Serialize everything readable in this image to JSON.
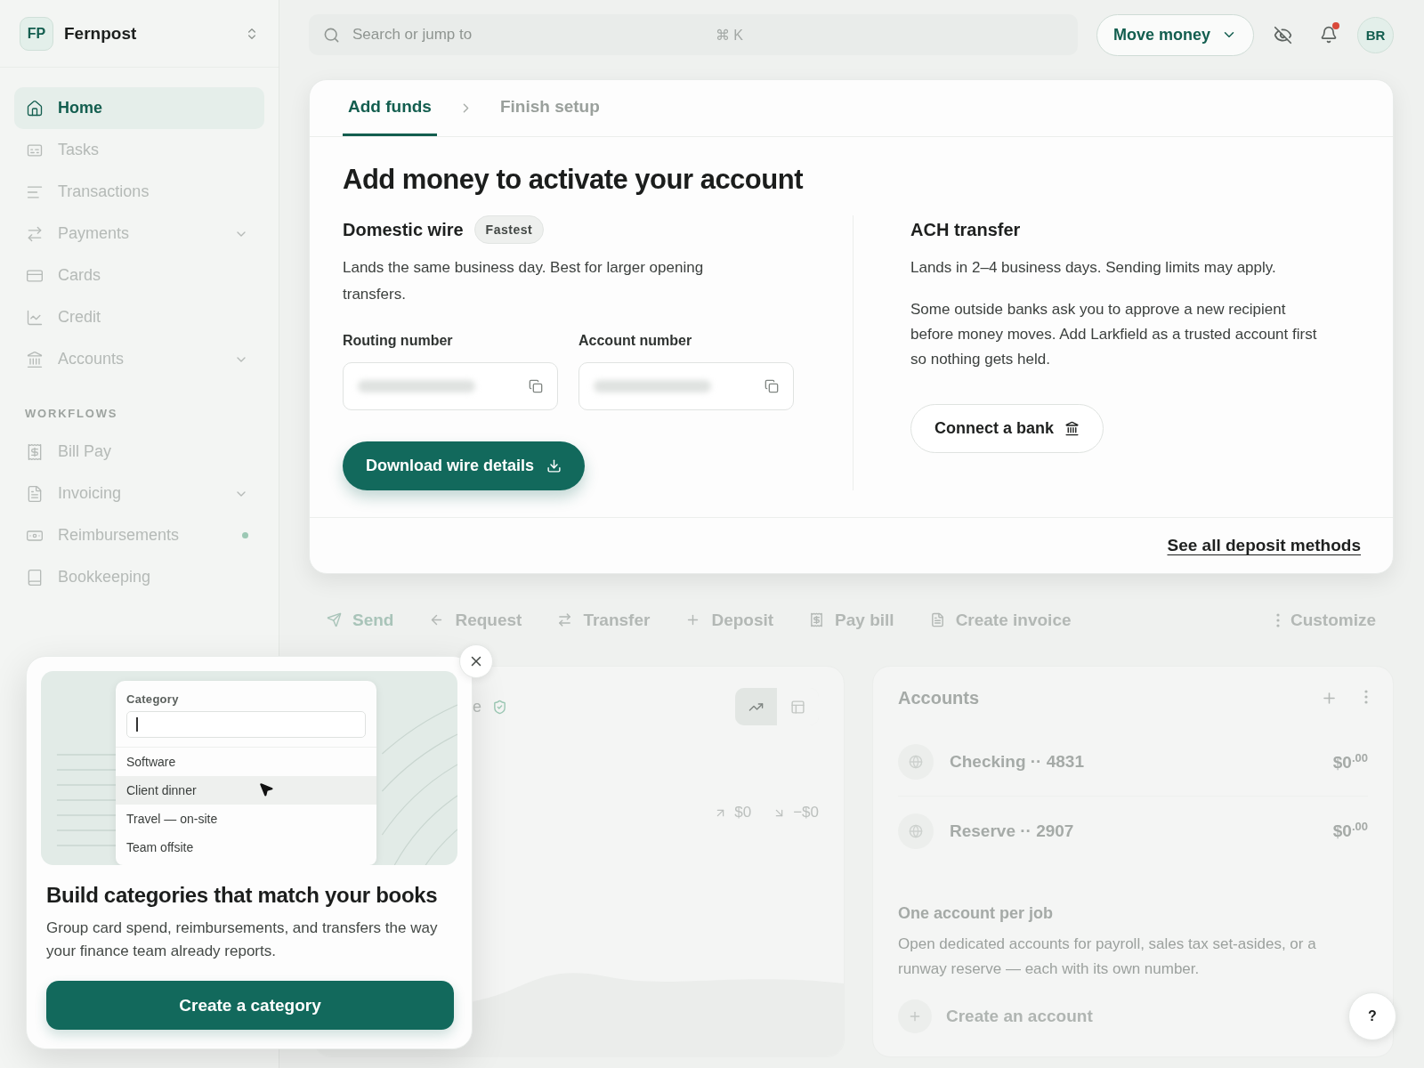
{
  "workspace": {
    "initials": "FP",
    "name": "Fernpost"
  },
  "sidebar": {
    "items": [
      {
        "label": "Home",
        "selected": true,
        "submenu": false,
        "dot": false
      },
      {
        "label": "Tasks",
        "selected": false,
        "submenu": false,
        "dot": false
      },
      {
        "label": "Transactions",
        "selected": false,
        "submenu": false,
        "dot": false
      },
      {
        "label": "Payments",
        "selected": false,
        "submenu": true,
        "dot": false
      },
      {
        "label": "Cards",
        "selected": false,
        "submenu": false,
        "dot": false
      },
      {
        "label": "Credit",
        "selected": false,
        "submenu": false,
        "dot": false
      },
      {
        "label": "Accounts",
        "selected": false,
        "submenu": true,
        "dot": false
      }
    ],
    "section_title": "WORKFLOWS",
    "workflow_items": [
      {
        "label": "Bill Pay",
        "selected": false,
        "submenu": false,
        "dot": false
      },
      {
        "label": "Invoicing",
        "selected": false,
        "submenu": true,
        "dot": false
      },
      {
        "label": "Reimbursements",
        "selected": false,
        "submenu": false,
        "dot": true
      },
      {
        "label": "Bookkeeping",
        "selected": false,
        "submenu": false,
        "dot": false
      }
    ]
  },
  "topbar": {
    "search": {
      "placeholder": "Search or jump to",
      "shortcut": "⌘ K"
    },
    "move_money": "Move money",
    "notifications_unread": true,
    "avatar": "BR"
  },
  "setup_card": {
    "tabs": [
      {
        "label": "Add funds",
        "selected": true
      },
      {
        "label": "Finish setup",
        "selected": false
      }
    ],
    "heading": "Add money to activate your account",
    "wire": {
      "title": "Domestic wire",
      "badge": "Fastest",
      "description": "Lands the same business day. Best for larger opening transfers.",
      "fields": [
        {
          "label": "Routing number"
        },
        {
          "label": "Account number"
        }
      ],
      "button": "Download wire details"
    },
    "ach": {
      "title": "ACH transfer",
      "description": "Lands in 2–4 business days. Sending limits may apply.",
      "note": "Some outside banks ask you to approve a new recipient before money moves. Add Larkfield as a trusted account first so nothing gets held.",
      "button": "Connect a bank"
    },
    "footer_link": "See all deposit methods"
  },
  "actions": [
    {
      "label": "Send"
    },
    {
      "label": "Request"
    },
    {
      "label": "Transfer"
    },
    {
      "label": "Deposit"
    },
    {
      "label": "Pay bill"
    },
    {
      "label": "Create invoice"
    }
  ],
  "customize": "Customize",
  "chart_card": {
    "title_fragment": "e",
    "views": [
      {
        "selected": true
      },
      {
        "selected": false
      }
    ],
    "inflow": "$0",
    "outflow": "−$0"
  },
  "accounts_card": {
    "title": "Accounts",
    "rows": [
      {
        "name": "Checking ·· 4831",
        "amount": "$0$^{.00}$"
      },
      {
        "name": "Reserve ·· 2907",
        "amount": "$0$^{.00}$"
      }
    ],
    "promo_title": "One account per job",
    "promo_text": "Open dedicated accounts for payroll, sales tax set-asides, or a runway reserve — each with its own number.",
    "create": "Create an account"
  },
  "popover": {
    "dropdown": {
      "label": "Category",
      "options": [
        {
          "label": "Software",
          "selected": false
        },
        {
          "label": "Client dinner",
          "selected": true
        },
        {
          "label": "Travel — on-site",
          "selected": false
        },
        {
          "label": "Team offsite",
          "selected": false
        }
      ]
    },
    "heading": "Build categories that match your books",
    "text": "Group card spend, reimbursements, and transfers the way your finance team already reports.",
    "button": "Create a category"
  },
  "help": "?"
}
